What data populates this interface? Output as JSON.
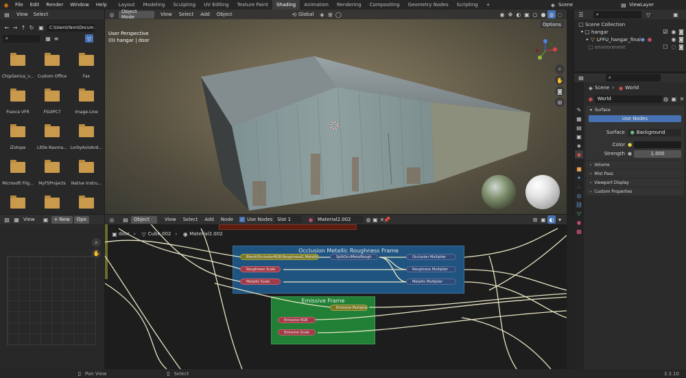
{
  "topbar": {
    "menus": [
      "File",
      "Edit",
      "Render",
      "Window",
      "Help"
    ],
    "tabs": [
      "Layout",
      "Modeling",
      "Sculpting",
      "UV Editing",
      "Texture Paint",
      "Shading",
      "Animation",
      "Rendering",
      "Compositing",
      "Geometry Nodes",
      "Scripting"
    ],
    "active_tab": "Shading",
    "add_tab": "+",
    "scene": "Scene",
    "viewlayer": "ViewLayer"
  },
  "filebrowser": {
    "view": "View",
    "select": "Select",
    "path": "C:\\Users\\Yann\\Docum...",
    "folders": [
      "ChipGenius_v...",
      "Custom Office",
      "Fax",
      "France VFR",
      "FSUIPC7",
      "Image-Line",
      "iZotope",
      "Little Navma...",
      "LorbyAxisAnd...",
      "Microsoft Flig...",
      "MyFSProjects",
      "Native Instru...",
      "",
      "",
      ""
    ]
  },
  "viewport": {
    "mode": "Object Mode",
    "menus": [
      "View",
      "Select",
      "Add",
      "Object"
    ],
    "orientation": "Global",
    "options": "Options",
    "perspective": "User Perspective",
    "object": "(0) hangar | door"
  },
  "outliner": {
    "collection": "Scene Collection",
    "items": [
      {
        "name": "hangar",
        "indent": 1
      },
      {
        "name": "LFFU_hangar_final",
        "indent": 2
      },
      {
        "name": "environment",
        "indent": 1
      }
    ]
  },
  "properties": {
    "breadcrumb": [
      "Scene",
      "World"
    ],
    "world_name": "World",
    "surface_panel": "Surface",
    "use_nodes": "Use Nodes",
    "surface_label": "Surface",
    "surface_value": "Background",
    "color_label": "Color",
    "strength_label": "Strength",
    "strength_value": "1.000",
    "collapsed_panels": [
      "Volume",
      "Mist Pass",
      "Viewport Display",
      "Custom Properties"
    ]
  },
  "node_editor": {
    "object_mode": "Object",
    "menus": [
      "View",
      "Select",
      "Add",
      "Node"
    ],
    "use_nodes": "Use Nodes",
    "slot": "Slot 1",
    "material": "Material2.002",
    "breadcrumb": [
      "door",
      "Cube.002",
      "Material2.002"
    ],
    "frame1_title": "Occlusion Metallic Roughness Frame",
    "frame2_title": "Emissive Frame",
    "nodes": {
      "blend": "Blend(OcclusionRGB,RoughnessG,MetallicB) Map",
      "split": "SplitOcclMetalRough",
      "occl_mult": "Occlusion Multiplier",
      "rough_scale": "Roughness Scale",
      "rough_mult": "Roughness Multiplier",
      "metal_scale": "Metallic Scale",
      "metal_mult": "Metallic Multiplier",
      "emis_mult": "Emissive Multiplier",
      "emis_rgb": "Emissive RGB",
      "emis_scale": "Emissive Scale"
    }
  },
  "leftbottom": {
    "view": "View",
    "new": "New",
    "open": "Ope"
  },
  "status": {
    "pan": "Pan View",
    "select": "Select",
    "version": "3.3.10"
  }
}
